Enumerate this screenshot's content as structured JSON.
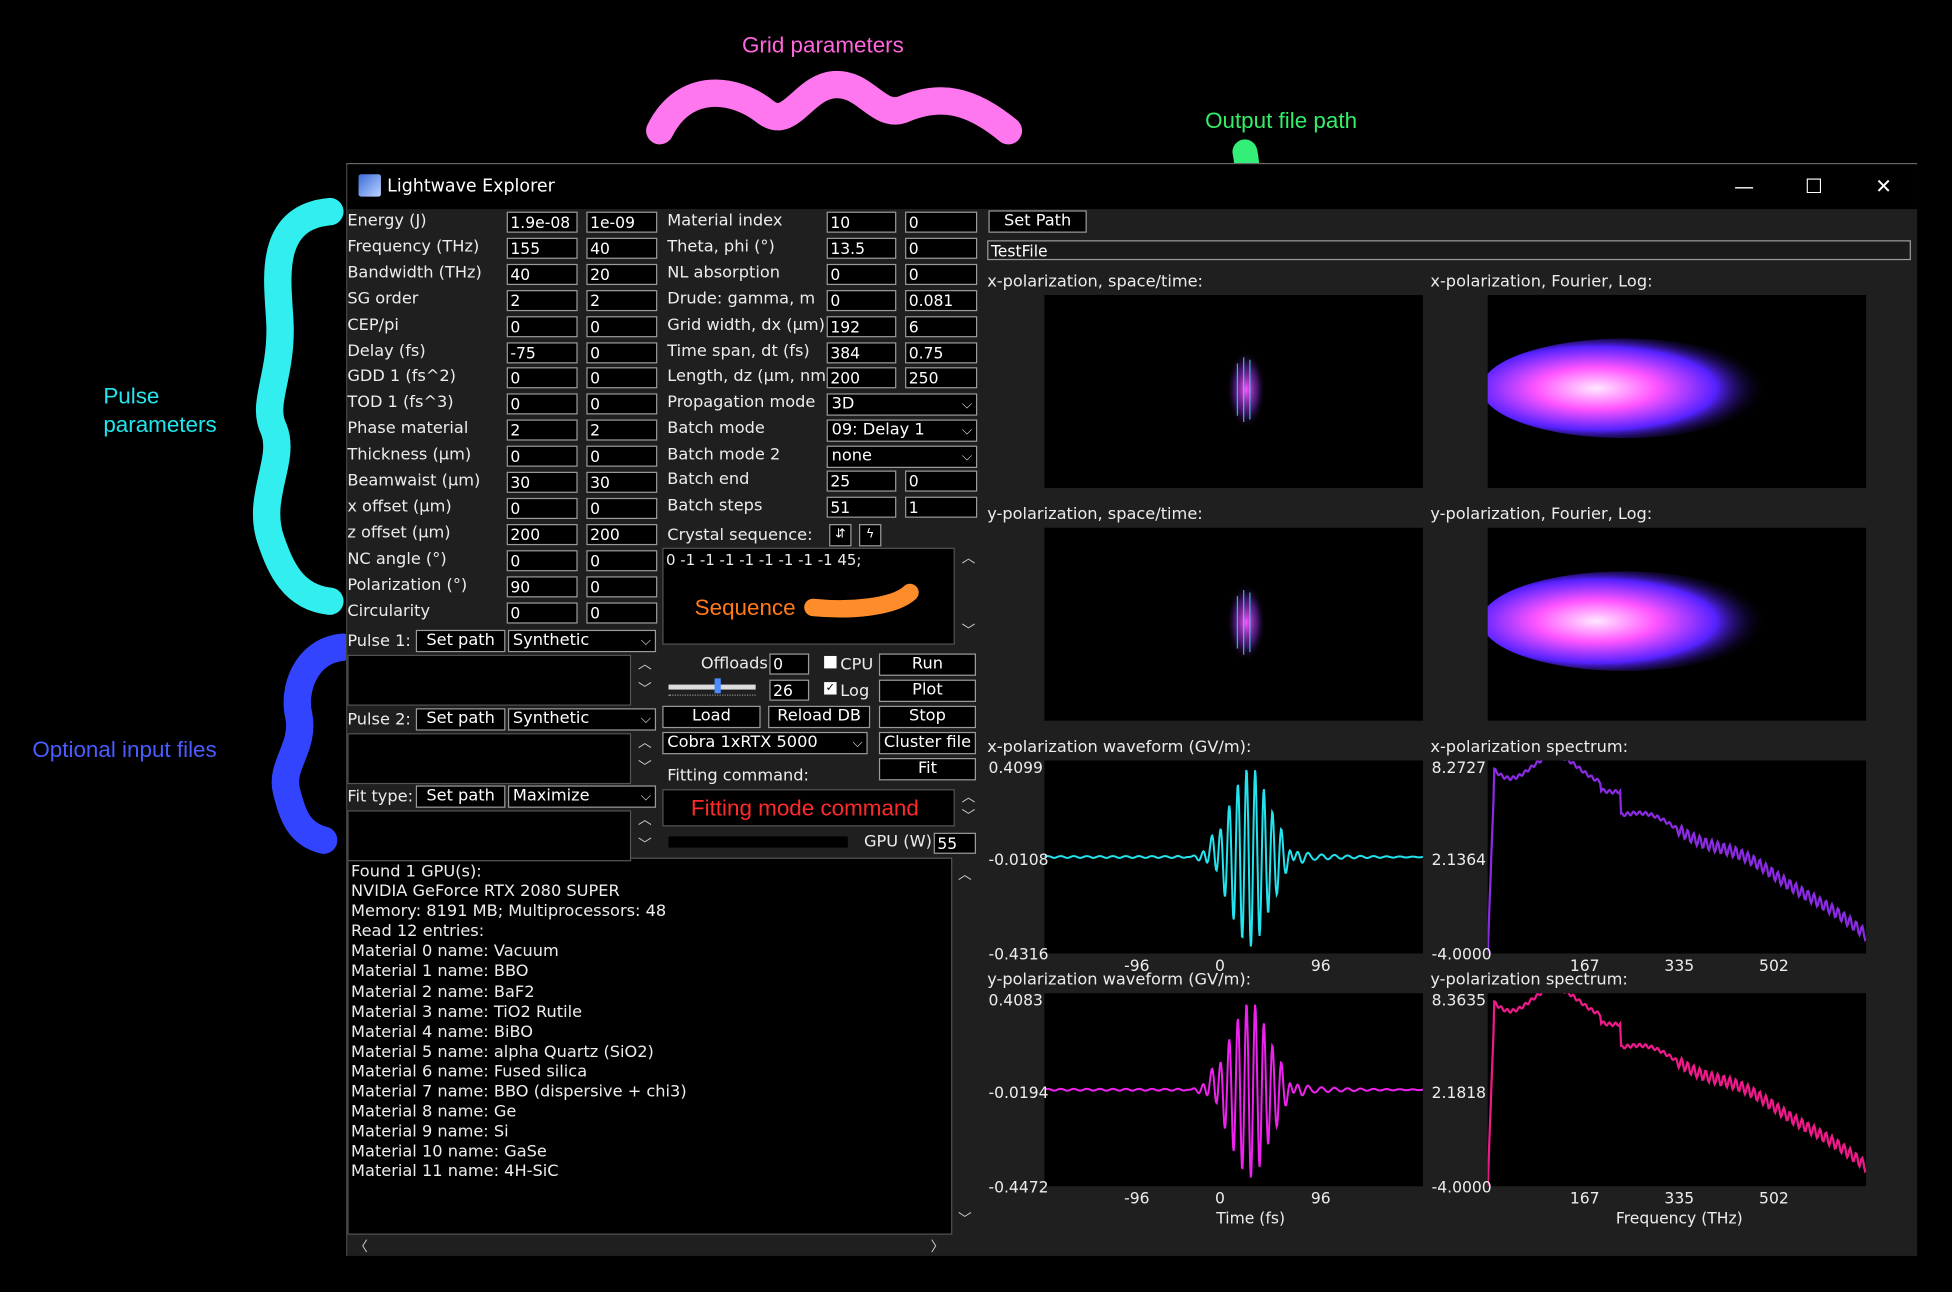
{
  "annotations": {
    "grid": "Grid parameters",
    "output": "Output file path",
    "pulse": "Pulse parameters",
    "optional": "Optional input files",
    "sequence": "Sequence",
    "fitting": "Fitting mode command"
  },
  "window": {
    "title": "Lightwave Explorer",
    "minimize": "—",
    "maximize": "☐",
    "close": "✕"
  },
  "pulse_params": [
    {
      "label": "Energy (J)",
      "v1": "1.9e-08",
      "v2": "1e-09"
    },
    {
      "label": "Frequency (THz)",
      "v1": "155",
      "v2": "40"
    },
    {
      "label": "Bandwidth (THz)",
      "v1": "40",
      "v2": "20"
    },
    {
      "label": "SG order",
      "v1": "2",
      "v2": "2"
    },
    {
      "label": "CEP/pi",
      "v1": "0",
      "v2": "0"
    },
    {
      "label": "Delay (fs)",
      "v1": "-75",
      "v2": "0"
    },
    {
      "label": "GDD 1 (fs^2)",
      "v1": "0",
      "v2": "0"
    },
    {
      "label": "TOD 1 (fs^3)",
      "v1": "0",
      "v2": "0"
    },
    {
      "label": "Phase material",
      "v1": "2",
      "v2": "2"
    },
    {
      "label": "Thickness (μm)",
      "v1": "0",
      "v2": "0"
    },
    {
      "label": "Beamwaist (μm)",
      "v1": "30",
      "v2": "30"
    },
    {
      "label": "x offset (μm)",
      "v1": "0",
      "v2": "0"
    },
    {
      "label": "z offset (μm)",
      "v1": "200",
      "v2": "200"
    },
    {
      "label": "NC angle (°)",
      "v1": "0",
      "v2": "0"
    },
    {
      "label": "Polarization (°)",
      "v1": "90",
      "v2": "0"
    },
    {
      "label": "Circularity",
      "v1": "0",
      "v2": "0"
    }
  ],
  "grid_params": [
    {
      "label": "Material index",
      "v1": "10",
      "v2": "0"
    },
    {
      "label": "Theta, phi (°)",
      "v1": "13.5",
      "v2": "0"
    },
    {
      "label": "NL absorption",
      "v1": "0",
      "v2": "0"
    },
    {
      "label": "Drude: gamma, m",
      "v1": "0",
      "v2": "0.081"
    },
    {
      "label": "Grid width, dx (μm)",
      "v1": "192",
      "v2": "6"
    },
    {
      "label": "Time span, dt (fs)",
      "v1": "384",
      "v2": "0.75"
    },
    {
      "label": "Length, dz (μm, nm)",
      "v1": "200",
      "v2": "250"
    }
  ],
  "mode_params": {
    "propagation_label": "Propagation mode",
    "propagation_value": "3D",
    "batch_label": "Batch mode",
    "batch_value": "09: Delay 1",
    "batch2_label": "Batch mode 2",
    "batch2_value": "none",
    "batch_end_label": "Batch end",
    "batch_end_v1": "25",
    "batch_end_v2": "0",
    "batch_steps_label": "Batch steps",
    "batch_steps_v1": "51",
    "batch_steps_v2": "1"
  },
  "crystal": {
    "label": "Crystal sequence:",
    "btn1": "⇵",
    "btn2": "ϟ",
    "sequence_text": "0 -1 -1 -1 -1 -1 -1 -1 -1 45;"
  },
  "files": [
    {
      "label": "Pulse 1:",
      "button": "Set path",
      "select": "Synthetic"
    },
    {
      "label": "Pulse 2:",
      "button": "Set path",
      "select": "Synthetic"
    },
    {
      "label": "Fit type:",
      "button": "Set path",
      "select": "Maximize"
    }
  ],
  "controls": {
    "offloads_label": "Offloads:",
    "offloads_value": "0",
    "cpu_label": "CPU",
    "log_label": "Log",
    "slider_value": "26",
    "slider_level": 0.55,
    "run": "Run",
    "plot": "Plot",
    "load": "Load",
    "reload": "Reload DB",
    "stop": "Stop",
    "gpu_select": "Cobra 1xRTX 5000",
    "cluster": "Cluster file",
    "fit": "Fit",
    "fitting_label": "Fitting command:",
    "gpu_label": "GPU (W)",
    "gpu_value": "55",
    "progress": 0
  },
  "output": {
    "set_path": "Set Path",
    "file": "TestFile"
  },
  "log": [
    "Found 1 GPU(s):",
    "NVIDIA GeForce RTX 2080 SUPER",
    " Memory: 8191 MB; Multiprocessors: 48",
    "Read 12 entries:",
    "Material 0 name: Vacuum",
    "Material 1 name: BBO",
    "Material 2 name: BaF2",
    "Material 3 name: TiO2 Rutile",
    "Material 4 name: BiBO",
    "Material 5 name: alpha Quartz (SiO2)",
    "Material 6 name: Fused silica",
    "Material 7 name: BBO (dispersive + chi3)",
    "Material 8 name: Ge",
    "Material 9 name: Si",
    "Material 10 name: GaSe",
    "Material 11 name: 4H-SiC"
  ],
  "plots": {
    "xst": "x-polarization, space/time:",
    "xf": "x-polarization, Fourier, Log:",
    "yst": "y-polarization, space/time:",
    "yf": "y-polarization, Fourier, Log:"
  },
  "chart_data": [
    {
      "type": "line",
      "title": "x-polarization waveform (GV/m):",
      "yticks": [
        "0.4099",
        "-0.0108",
        "-0.4316"
      ],
      "xticks": [
        "-96",
        "0",
        "96"
      ],
      "ylim": [
        -0.4316,
        0.4099
      ],
      "color": "#22e3ee"
    },
    {
      "type": "line",
      "title": "x-polarization spectrum:",
      "yticks": [
        "8.2727",
        "2.1364",
        "-4.0000"
      ],
      "xticks": [
        "167",
        "335",
        "502"
      ],
      "ylim": [
        -4.0,
        8.2727
      ],
      "color": "#8a2be2"
    },
    {
      "type": "line",
      "title": "y-polarization waveform (GV/m):",
      "yticks": [
        "0.4083",
        "-0.0194",
        "-0.4472"
      ],
      "xticks": [
        "-96",
        "0",
        "96"
      ],
      "xlabel": "Time (fs)",
      "ylim": [
        -0.4472,
        0.4083
      ],
      "color": "#ee22ee"
    },
    {
      "type": "line",
      "title": "y-polarization spectrum:",
      "yticks": [
        "8.3635",
        "2.1818",
        "-4.0000"
      ],
      "xticks": [
        "167",
        "335",
        "502"
      ],
      "xlabel": "Frequency (THz)",
      "ylim": [
        -4.0,
        8.3635
      ],
      "color": "#ee1a8a"
    }
  ]
}
